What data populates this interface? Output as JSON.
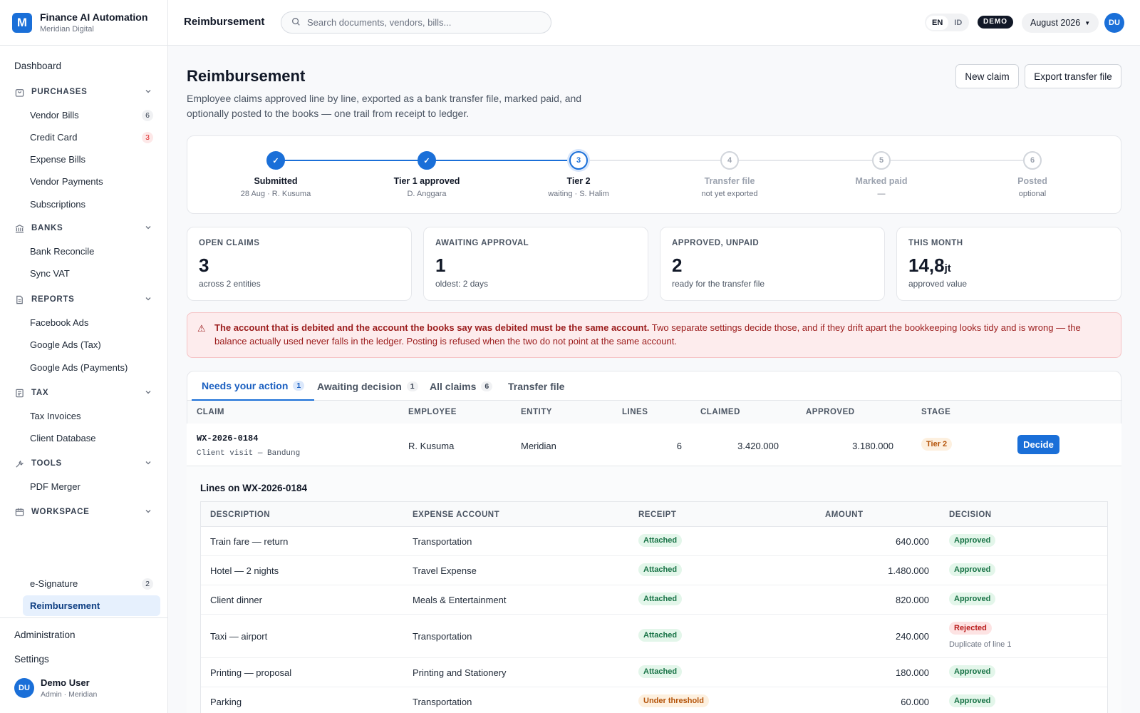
{
  "app": {
    "name": "Finance AI Automation",
    "org": "Meridian Digital",
    "logo_letter": "M"
  },
  "nav": {
    "dashboard": "Dashboard",
    "sections": [
      {
        "label": "PURCHASES",
        "icon": "bag-icon"
      },
      {
        "label": "BANKS",
        "icon": "bank-icon"
      },
      {
        "label": "REPORTS",
        "icon": "report-icon"
      },
      {
        "label": "TAX",
        "icon": "tax-icon"
      },
      {
        "label": "TOOLS",
        "icon": "wrench-icon"
      },
      {
        "label": "WORKSPACE",
        "icon": "workspace-icon"
      }
    ],
    "items": [
      {
        "label": "Vendor Bills",
        "badge": "6"
      },
      {
        "label": "Credit Card",
        "badge": "3"
      },
      {
        "label": "Expense Bills"
      },
      {
        "label": "Vendor Payments"
      },
      {
        "label": "Subscriptions"
      },
      {
        "label": "Bank Reconcile"
      },
      {
        "label": "Sync VAT"
      },
      {
        "label": "Facebook Ads"
      },
      {
        "label": "Google Ads (Tax)"
      },
      {
        "label": "Google Ads (Payments)"
      },
      {
        "label": "Tax Invoices"
      },
      {
        "label": "Client Database"
      },
      {
        "label": "PDF Merger"
      },
      {
        "label": "e-Signature",
        "badge": "2"
      },
      {
        "label": "Reimbursement"
      }
    ],
    "administration": "Administration",
    "settings": "Settings",
    "user": {
      "initials": "DU",
      "name": "Demo User",
      "role": "Admin · Meridian"
    }
  },
  "topbar": {
    "title": "Reimbursement",
    "search_placeholder": "Search documents, vendors, bills...",
    "lang": [
      "EN",
      "ID"
    ],
    "demo": "DEMO",
    "period": "August 2026",
    "avatar": "DU"
  },
  "page": {
    "title": "Reimbursement",
    "subtitle": "Employee claims approved line by line, exported as a bank transfer file, marked paid, and optionally posted to the books — one trail from receipt to ledger.",
    "new_claim": "New claim",
    "export": "Export transfer file"
  },
  "steps": [
    {
      "n": "✓",
      "label": "Submitted",
      "sub": "28 Aug · R. Kusuma",
      "state": "done"
    },
    {
      "n": "✓",
      "label": "Tier 1 approved",
      "sub": "D. Anggara",
      "state": "done"
    },
    {
      "n": "3",
      "label": "Tier 2",
      "sub": "waiting · S. Halim",
      "state": "cur"
    },
    {
      "n": "4",
      "label": "Transfer file",
      "sub": "not yet exported",
      "state": "todo"
    },
    {
      "n": "5",
      "label": "Marked paid",
      "sub": "—",
      "state": "todo"
    },
    {
      "n": "6",
      "label": "Posted",
      "sub": "optional",
      "state": "todo"
    }
  ],
  "kpis": [
    {
      "label": "OPEN CLAIMS",
      "value": "3",
      "unit": "",
      "sub": "across 2 entities"
    },
    {
      "label": "AWAITING APPROVAL",
      "value": "1",
      "unit": "",
      "sub": "oldest: 2 days"
    },
    {
      "label": "APPROVED, UNPAID",
      "value": "2",
      "unit": "",
      "sub": "ready for the transfer file"
    },
    {
      "label": "THIS MONTH",
      "value": "14,8",
      "unit": "jt",
      "sub": "approved value"
    }
  ],
  "alert": {
    "bold": "The account that is debited and the account the books say was debited must be the same account.",
    "text": " Two separate settings decide those, and if they drift apart the bookkeeping looks tidy and is wrong — the balance actually used never falls in the ledger. Posting is refused when the two do not point at the same account."
  },
  "tabs": [
    {
      "label": "Needs your action",
      "count": "1"
    },
    {
      "label": "Awaiting decision",
      "count": "1"
    },
    {
      "label": "All claims",
      "count": "6"
    },
    {
      "label": "Transfer file",
      "count": ""
    }
  ],
  "claims_table": {
    "headers": [
      "CLAIM",
      "EMPLOYEE",
      "ENTITY",
      "LINES",
      "CLAIMED",
      "APPROVED",
      "STAGE"
    ],
    "row": {
      "id": "WX-2026-0184",
      "desc": "Client visit — Bandung",
      "employee": "R. Kusuma",
      "entity": "Meridian",
      "lines": "6",
      "claimed": "3.420.000",
      "approved": "3.180.000",
      "stage": "Tier 2",
      "action": "Decide"
    }
  },
  "lines": {
    "title": "Lines on WX-2026-0184",
    "headers": [
      "DESCRIPTION",
      "EXPENSE ACCOUNT",
      "RECEIPT",
      "AMOUNT",
      "DECISION"
    ],
    "rows": [
      {
        "desc": "Train fare — return",
        "account": "Transportation",
        "receipt": "Attached",
        "amount": "640.000",
        "decision": "Approved",
        "note": ""
      },
      {
        "desc": "Hotel — 2 nights",
        "account": "Travel Expense",
        "receipt": "Attached",
        "amount": "1.480.000",
        "decision": "Approved",
        "note": ""
      },
      {
        "desc": "Client dinner",
        "account": "Meals & Entertainment",
        "receipt": "Attached",
        "amount": "820.000",
        "decision": "Approved",
        "note": ""
      },
      {
        "desc": "Taxi — airport",
        "account": "Transportation",
        "receipt": "Attached",
        "amount": "240.000",
        "decision": "Rejected",
        "note": "Duplicate of line 1"
      },
      {
        "desc": "Printing — proposal",
        "account": "Printing and Stationery",
        "receipt": "Attached",
        "amount": "180.000",
        "decision": "Approved",
        "note": ""
      },
      {
        "desc": "Parking",
        "account": "Transportation",
        "receipt": "Under threshold",
        "amount": "60.000",
        "decision": "Approved",
        "note": ""
      }
    ]
  }
}
